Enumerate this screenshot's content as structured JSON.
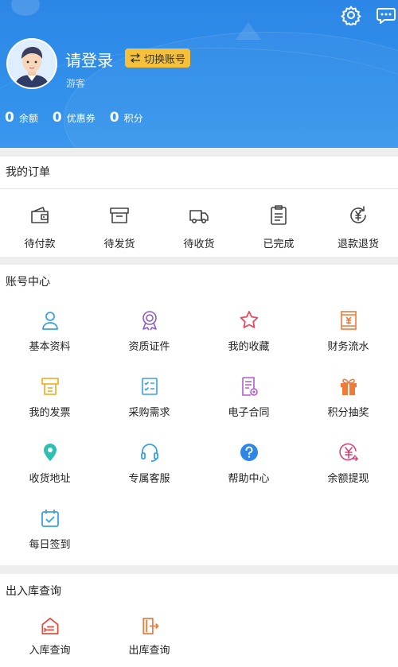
{
  "header": {
    "login_text": "请登录",
    "switch_label": "切换账号",
    "guest_label": "游客",
    "settings_icon": "gear-icon",
    "message_icon": "message-icon",
    "colors": {
      "background": "#2f8de8",
      "switch_bg": "#f5c13a"
    },
    "stats": [
      {
        "value": "0",
        "label": "余额"
      },
      {
        "value": "0",
        "label": "优惠券"
      },
      {
        "value": "0",
        "label": "积分"
      }
    ]
  },
  "orders": {
    "title": "我的订单",
    "items": [
      {
        "label": "待付款",
        "icon": "wallet-icon"
      },
      {
        "label": "待发货",
        "icon": "box-icon"
      },
      {
        "label": "待收货",
        "icon": "truck-icon"
      },
      {
        "label": "已完成",
        "icon": "clipboard-icon"
      },
      {
        "label": "退款退货",
        "icon": "refund-icon"
      }
    ]
  },
  "account": {
    "title": "账号中心",
    "items": [
      {
        "label": "基本资料",
        "icon": "user-icon",
        "color": "#3aa0e8"
      },
      {
        "label": "资质证件",
        "icon": "award-icon",
        "color": "#8b5cc7"
      },
      {
        "label": "我的收藏",
        "icon": "star-icon",
        "color": "#e84a5f"
      },
      {
        "label": "财务流水",
        "icon": "receipt-icon",
        "color": "#f07a3a"
      },
      {
        "label": "我的发票",
        "icon": "invoice-icon",
        "color": "#f2b233"
      },
      {
        "label": "采购需求",
        "icon": "checklist-icon",
        "color": "#3aa0e8"
      },
      {
        "label": "电子合同",
        "icon": "contract-icon",
        "color": "#b35ad6"
      },
      {
        "label": "积分抽奖",
        "icon": "gift-icon",
        "color": "#f07a3a"
      },
      {
        "label": "收货地址",
        "icon": "location-icon",
        "color": "#2cc0b0"
      },
      {
        "label": "专属客服",
        "icon": "headset-icon",
        "color": "#3aa0e8"
      },
      {
        "label": "帮助中心",
        "icon": "help-icon",
        "color": "#2e86e8"
      },
      {
        "label": "余额提现",
        "icon": "withdraw-icon",
        "color": "#d6457c"
      },
      {
        "label": "每日签到",
        "icon": "calendar-icon",
        "color": "#3aa0e8"
      }
    ]
  },
  "inout": {
    "title": "出入库查询",
    "items": [
      {
        "label": "入库查询",
        "icon": "warehouse-in-icon",
        "color": "#e84a3a"
      },
      {
        "label": "出库查询",
        "icon": "warehouse-out-icon",
        "color": "#f07a3a"
      }
    ]
  }
}
